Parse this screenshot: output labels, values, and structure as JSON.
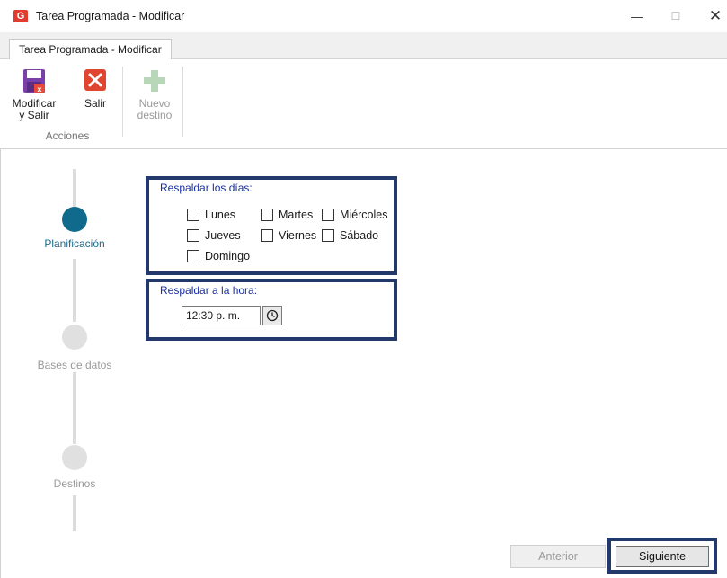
{
  "window": {
    "title": "Tarea Programada - Modificar",
    "app_icon_glyph": "G",
    "minimize_glyph": "—",
    "maximize_glyph": "☐",
    "close_glyph": "✕"
  },
  "ribbon": {
    "tab": "Tarea Programada - Modificar",
    "buttons": {
      "save": {
        "line1": "Modificar",
        "line2": "y Salir",
        "icon": "save-icon"
      },
      "exit": {
        "line1": "Salir",
        "icon": "close-icon"
      },
      "new_destination": {
        "line1": "Nuevo",
        "line2": "destino",
        "icon": "plus-icon",
        "disabled": true
      }
    },
    "group_label": "Acciones"
  },
  "wizard": {
    "steps": [
      {
        "label": "Planificación",
        "active": true
      },
      {
        "label": "Bases de datos",
        "active": false
      },
      {
        "label": "Destinos",
        "active": false
      }
    ],
    "days_group": {
      "title": "Respaldar los días:",
      "days": [
        "Lunes",
        "Martes",
        "Miércoles",
        "Jueves",
        "Viernes",
        "Sábado",
        "Domingo"
      ]
    },
    "time_group": {
      "title": "Respaldar a la hora:",
      "value": "12:30 p. m."
    },
    "buttons": {
      "previous": "Anterior",
      "next": "Siguiente"
    }
  },
  "colors": {
    "active_step": "#0f6a8c",
    "highlight_border": "#23386b",
    "group_title": "#1a2fa0"
  }
}
